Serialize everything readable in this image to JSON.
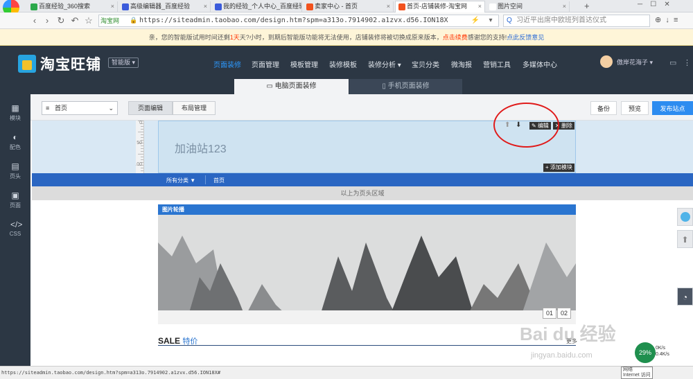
{
  "browser": {
    "tabs": [
      {
        "label": "百度经验_360搜索",
        "fav": "#2ba84a"
      },
      {
        "label": "高级编辑器_百度经验",
        "fav": "#3b5bdb"
      },
      {
        "label": "我的经验_个人中心_百度经验",
        "fav": "#3b5bdb"
      },
      {
        "label": "卖家中心 - 首页",
        "fav": "#f2521e"
      },
      {
        "label": "首页-店铺装修-淘宝网",
        "fav": "#f2521e"
      },
      {
        "label": "图片空间",
        "fav": "#ffffff"
      }
    ],
    "active_tab": 4,
    "site_tag": "淘宝网",
    "url": "https://siteadmin.taobao.com/design.htm?spm=a313o.7914902.a1zvx.d56.ION18X",
    "search": "习近平出席中欧班列首达仪式"
  },
  "notice": {
    "pre": "亲，您的智能版试用时间还剩",
    "days": "1天",
    "mid": "天?小时，到期后智能版功能将无法使用，店铺装修将被切换成原来版本，",
    "link": "点击续费",
    "post": "感谢您的支持!",
    "link2": "点此反馈意见"
  },
  "topnav": {
    "logo": "淘宝旺铺",
    "edition": "智能版 ▾",
    "menu": [
      "页面装修",
      "页面管理",
      "模板管理",
      "装修模板",
      "装修分析 ▾",
      "宝贝分类",
      "微淘报",
      "营销工具",
      "多媒体中心"
    ],
    "active_menu": 0,
    "user": "傲岸花海子 ▾",
    "pc_mode": "电脑页面装修",
    "mobile_mode": "手机页面装修"
  },
  "sidebar": [
    {
      "icon": "▦",
      "label": "模块"
    },
    {
      "icon": "◐",
      "label": "配色"
    },
    {
      "icon": "▤",
      "label": "页头"
    },
    {
      "icon": "▣",
      "label": "页面"
    },
    {
      "icon": "</>",
      "label": "CSS"
    }
  ],
  "toolbar": {
    "page_select": "首页",
    "tabs": [
      "页面编辑",
      "布局管理"
    ],
    "backup": "备份",
    "preview": "预览",
    "publish": "发布站点"
  },
  "ruler": [
    "0",
    "50",
    "100",
    "150"
  ],
  "header_area": {
    "shop_name": "加油站123",
    "edit": "编辑",
    "delete": "删除",
    "add_module": "+ 添加模块",
    "nav_all": "所有分类 ▼",
    "nav_home": "首页",
    "region_label": "以上为页头区域"
  },
  "carousel": {
    "title": "图片轮播",
    "pages": [
      "01",
      "02"
    ]
  },
  "sale": {
    "title": "SALE",
    "subtitle": "特价",
    "more": "更多"
  },
  "status_bar": {
    "url": "https://siteadmin.taobao.com/design.htm?spm=a313o.7914902.a1zvx.d56.ION18X#",
    "cpu": "29%",
    "up": "0K/s",
    "down": "0.4K/s",
    "net": "网络",
    "net2": "Internet 访问"
  },
  "watermark": {
    "text": "Bai du 经验",
    "url": "jingyan.baidu.com"
  },
  "colors": {
    "nav_bg": "#2c3744",
    "accent": "#2d8cf0",
    "header_strip": "#2a66c2",
    "annotation": "#e01a1a"
  }
}
